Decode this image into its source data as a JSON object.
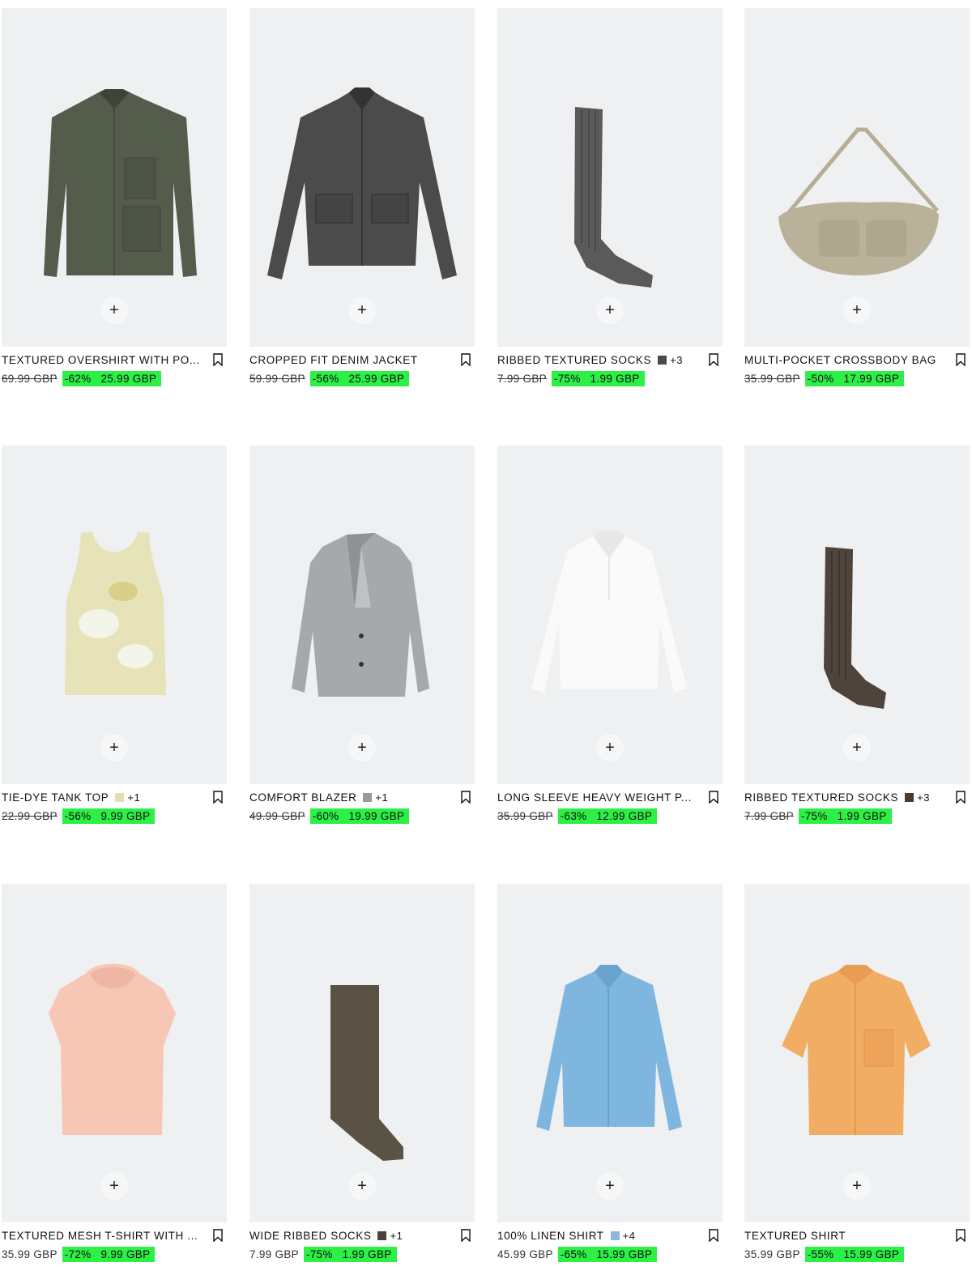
{
  "add_label": "+",
  "products": [
    {
      "name": "TEXTURED OVERSHIRT WITH PO...",
      "old_price": "69.99 GBP",
      "discount": "-62%",
      "price": "25.99 GBP",
      "swatch": "",
      "more": ""
    },
    {
      "name": "CROPPED FIT DENIM JACKET",
      "old_price": "59.99 GBP",
      "discount": "-56%",
      "price": "25.99 GBP",
      "swatch": "",
      "more": ""
    },
    {
      "name": "RIBBED TEXTURED SOCKS",
      "old_price": "7.99 GBP",
      "discount": "-75%",
      "price": "1.99 GBP",
      "swatch": "#4a4a4a",
      "more": "+3"
    },
    {
      "name": "MULTI-POCKET CROSSBODY BAG",
      "old_price": "35.99 GBP",
      "discount": "-50%",
      "price": "17.99 GBP",
      "swatch": "",
      "more": ""
    },
    {
      "name": "TIE-DYE TANK TOP",
      "old_price": "22.99 GBP",
      "discount": "-56%",
      "price": "9.99 GBP",
      "swatch": "#e3dfb5",
      "more": "+1"
    },
    {
      "name": "COMFORT BLAZER",
      "old_price": "49.99 GBP",
      "discount": "-60%",
      "price": "19.99 GBP",
      "swatch": "#9a9a9a",
      "more": "+1"
    },
    {
      "name": "LONG SLEEVE HEAVY WEIGHT P...",
      "old_price": "35.99 GBP",
      "discount": "-63%",
      "price": "12.99 GBP",
      "swatch": "",
      "more": ""
    },
    {
      "name": "RIBBED TEXTURED SOCKS",
      "old_price": "7.99 GBP",
      "discount": "-75%",
      "price": "1.99 GBP",
      "swatch": "#4a3a32",
      "more": "+3"
    },
    {
      "name": "TEXTURED MESH T-SHIRT WITH ...",
      "old_price": "35.99 GBP",
      "discount": "-72%",
      "price": "9.99 GBP",
      "swatch": "",
      "more": ""
    },
    {
      "name": "WIDE RIBBED SOCKS",
      "old_price": "7.99 GBP",
      "discount": "-75%",
      "price": "1.99 GBP",
      "swatch": "#4b423c",
      "more": "+1"
    },
    {
      "name": "100% LINEN SHIRT",
      "old_price": "45.99 GBP",
      "discount": "-65%",
      "price": "15.99 GBP",
      "swatch": "#8fb7dc",
      "more": "+4"
    },
    {
      "name": "TEXTURED SHIRT",
      "old_price": "35.99 GBP",
      "discount": "-55%",
      "price": "15.99 GBP",
      "swatch": "",
      "more": ""
    }
  ],
  "colors": {
    "sale_highlight": "#2cf046",
    "image_bg": "#eef0f2"
  }
}
